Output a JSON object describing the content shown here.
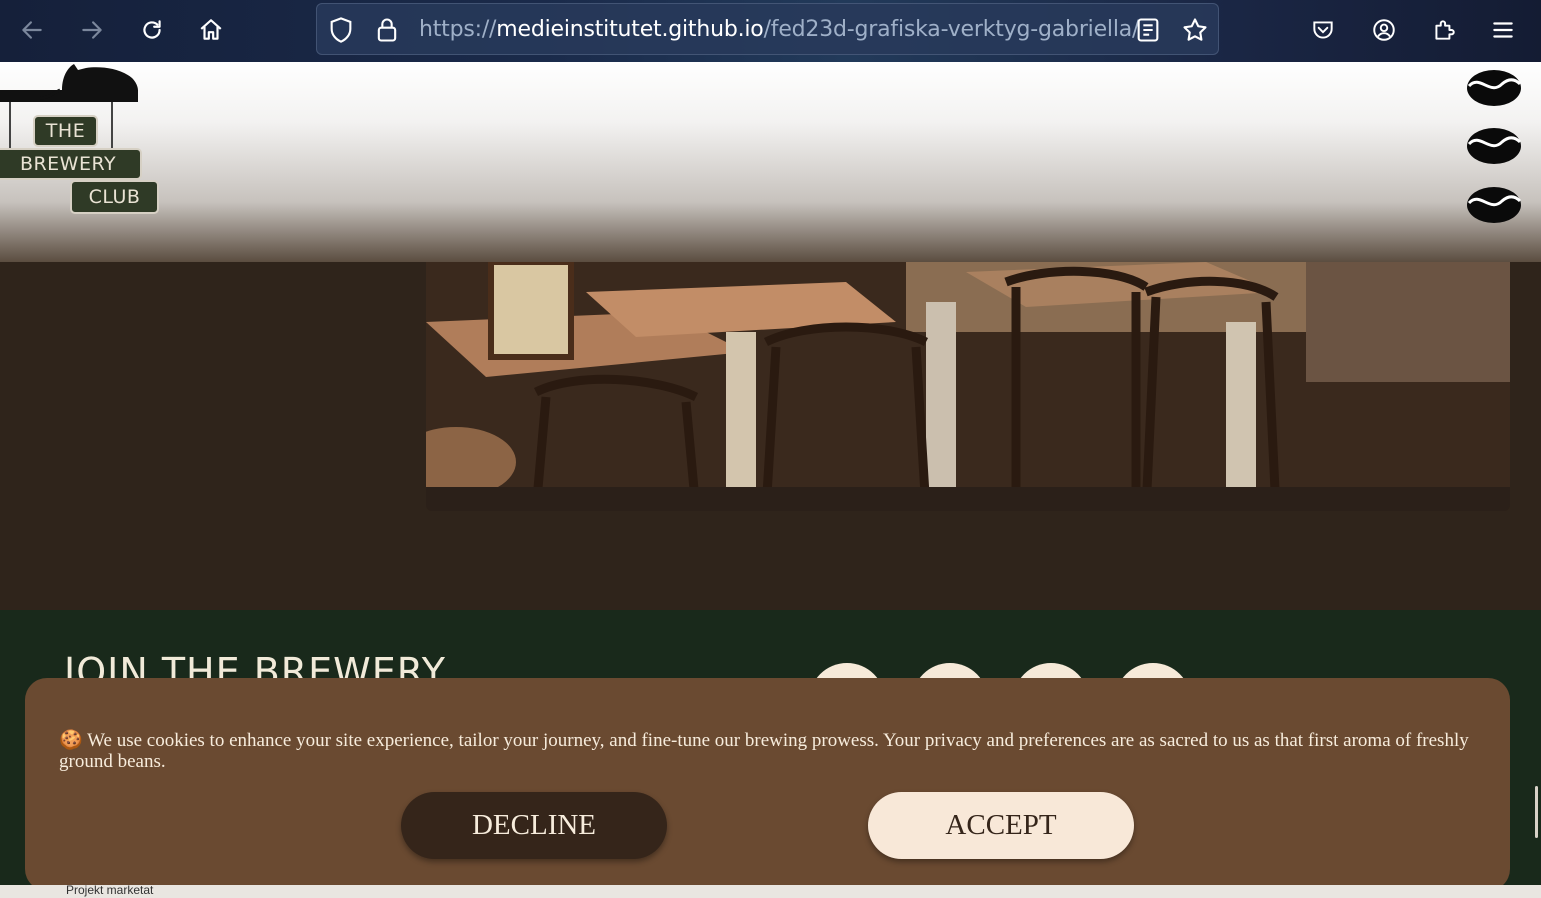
{
  "browser": {
    "url_prefix": "https://",
    "url_host": "medieinstitutet.github.io",
    "url_path": "/fed23d-grafiska-verktyg-gabriella/",
    "icons": [
      "back-icon",
      "forward-icon",
      "reload-icon",
      "home-icon",
      "shield-icon",
      "lock-icon",
      "reader-view-icon",
      "bookmark-star-icon",
      "pocket-icon",
      "account-icon",
      "extensions-icon",
      "menu-icon"
    ]
  },
  "logo": {
    "line1": "THE",
    "line2": "BREWERY",
    "line3": "CLUB"
  },
  "join": {
    "title": "JOIN THE BREWERY"
  },
  "cookie": {
    "emoji": "🍪",
    "text": "We use cookies to enhance your site experience, tailor your journey, and fine-tune our brewing prowess. Your privacy and preferences are as sacred to us as that first aroma of freshly ground beans.",
    "decline_label": "DECLINE",
    "accept_label": "ACCEPT"
  },
  "bottom_strip": {
    "text": "Projekt marketat"
  },
  "colors": {
    "header_bg": "#f3f2f1",
    "main_bg": "#2f241b",
    "join_bg": "#19291b",
    "banner_bg": "#6a4a31",
    "decline_bg": "#35251a",
    "accept_bg": "#f8e8d8"
  }
}
